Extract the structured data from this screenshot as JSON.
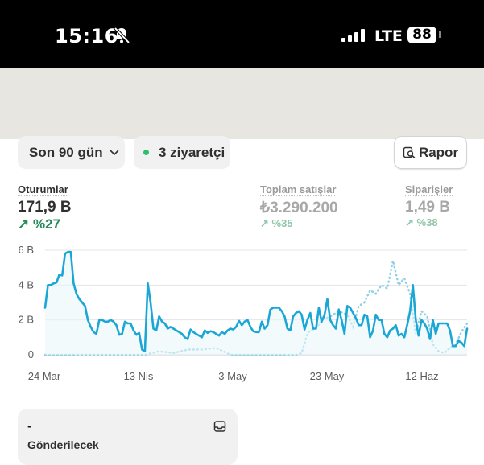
{
  "status_bar": {
    "time": "15:16",
    "network": "LTE",
    "battery": "88",
    "icons": [
      "bell-slash-icon",
      "signal-icon"
    ]
  },
  "filters": {
    "period_label": "Son 90 gün",
    "visitors_label": "3 ziyaretçi",
    "report_label": "Rapor",
    "live_color": "#29c26a"
  },
  "metrics": [
    {
      "label": "Oturumlar",
      "value": "171,9 B",
      "change": "%27"
    },
    {
      "label": "Toplam satışlar",
      "value": "₺3.290.200",
      "change": "%35"
    },
    {
      "label": "Siparişler",
      "value": "1,49 B",
      "change": "%38"
    }
  ],
  "colors": {
    "series_primary": "#1ba7d6",
    "series_secondary": "#8fd0e4",
    "positive": "#2a8a5a"
  },
  "chart_data": {
    "type": "line",
    "ylim": [
      0,
      6000
    ],
    "y_ticks": [
      "0",
      "2 B",
      "4 B",
      "6 B"
    ],
    "x_ticks": [
      "24 Mar",
      "13 Nis",
      "3 May",
      "23 May",
      "12 Haz"
    ],
    "grid": true,
    "series": [
      {
        "style": "solid",
        "values": [
          2700,
          4000,
          4000,
          4100,
          4150,
          4600,
          4550,
          5800,
          5900,
          5900,
          4100,
          3500,
          3200,
          3000,
          2800,
          2000,
          1600,
          1300,
          1200,
          2000,
          2000,
          1900,
          1900,
          2000,
          1900,
          1700,
          1150,
          1200,
          1900,
          1800,
          1800,
          1400,
          1150,
          1250,
          300,
          200,
          4100,
          3000,
          1500,
          1400,
          2200,
          1900,
          1800,
          1500,
          1600,
          1500,
          1400,
          1300,
          1200,
          1000,
          900,
          1450,
          1300,
          1200,
          1100,
          1000,
          1400,
          1250,
          1350,
          1300,
          1200,
          1100,
          1300,
          1200,
          1400,
          1500,
          1450,
          1600,
          1950,
          1700,
          1900,
          2000,
          1600,
          1350,
          1300,
          1300,
          1900,
          1500,
          1700,
          2600,
          2700,
          2700,
          2700,
          2500,
          2200,
          1500,
          1400,
          2200,
          2400,
          2500,
          2300,
          1450,
          2000,
          2400,
          1500,
          1500,
          2700,
          1900,
          2300,
          3200,
          2000,
          1700,
          1500,
          2600,
          2000,
          1200,
          2800,
          2700,
          2400,
          2100,
          1700,
          1700,
          2300,
          2200,
          1000,
          1400,
          2300,
          2000,
          2000,
          1200,
          1000,
          1400,
          1500,
          1700,
          1100,
          1200,
          1000,
          1700,
          2500,
          4000,
          2000,
          1100,
          2000,
          1800,
          1500,
          900,
          2000,
          1200,
          1800,
          1800,
          1800,
          1800,
          1400,
          500,
          500,
          800,
          700,
          500,
          1500
        ]
      },
      {
        "style": "dotted",
        "values": [
          0,
          0,
          0,
          0,
          0,
          0,
          0,
          0,
          0,
          0,
          0,
          0,
          0,
          0,
          0,
          0,
          0,
          0,
          0,
          0,
          0,
          0,
          0,
          0,
          0,
          0,
          0,
          0,
          0,
          0,
          0,
          0,
          0,
          0,
          0,
          0,
          0,
          0,
          0,
          0,
          0,
          0,
          0,
          0,
          0,
          0,
          0,
          0,
          0,
          0,
          0,
          0,
          0,
          0,
          0,
          0,
          0,
          0,
          0,
          0,
          0,
          0,
          0,
          0,
          0,
          0,
          0,
          0,
          0,
          0,
          0,
          0,
          0,
          0,
          0,
          0,
          0,
          0,
          0,
          0,
          0,
          0,
          0,
          0,
          0,
          0,
          0,
          0,
          0,
          0,
          0,
          0,
          0,
          0,
          0,
          0,
          0,
          0,
          0,
          0,
          0,
          0,
          0,
          0,
          0,
          0,
          0,
          0,
          0,
          0,
          0,
          0,
          0,
          0,
          0,
          0,
          0,
          0,
          0,
          0,
          0,
          0,
          0,
          0,
          0,
          0,
          0,
          0,
          0,
          0,
          0,
          0,
          0,
          0,
          0,
          0,
          0,
          0,
          0,
          0,
          0,
          0,
          0,
          0,
          0,
          0,
          0,
          0,
          0,
          0
        ],
        "overrides": [
          [
            20,
            0
          ],
          [
            35,
            0
          ],
          [
            40,
            200
          ],
          [
            45,
            100
          ],
          [
            50,
            300
          ],
          [
            55,
            300
          ],
          [
            60,
            400
          ],
          [
            65,
            0
          ],
          [
            70,
            0
          ],
          [
            75,
            0
          ],
          [
            80,
            0
          ],
          [
            85,
            0
          ],
          [
            88,
            0
          ],
          [
            90,
            100
          ],
          [
            92,
            1200
          ],
          [
            93,
            1400
          ],
          [
            95,
            1500
          ],
          [
            97,
            2000
          ],
          [
            100,
            2200
          ],
          [
            103,
            2500
          ],
          [
            106,
            2300
          ],
          [
            108,
            1600
          ],
          [
            110,
            2800
          ],
          [
            112,
            3000
          ],
          [
            114,
            3700
          ],
          [
            116,
            3500
          ],
          [
            118,
            4000
          ],
          [
            120,
            3800
          ],
          [
            122,
            5400
          ],
          [
            124,
            4000
          ],
          [
            126,
            4400
          ],
          [
            128,
            3500
          ],
          [
            130,
            1200
          ],
          [
            132,
            2500
          ],
          [
            134,
            2200
          ],
          [
            136,
            600
          ],
          [
            138,
            200
          ],
          [
            140,
            100
          ],
          [
            142,
            400
          ],
          [
            144,
            600
          ],
          [
            146,
            1300
          ],
          [
            148,
            1800
          ],
          [
            150,
            2500
          ]
        ]
      }
    ]
  },
  "card": {
    "value": "-",
    "label": "Gönderilecek"
  }
}
